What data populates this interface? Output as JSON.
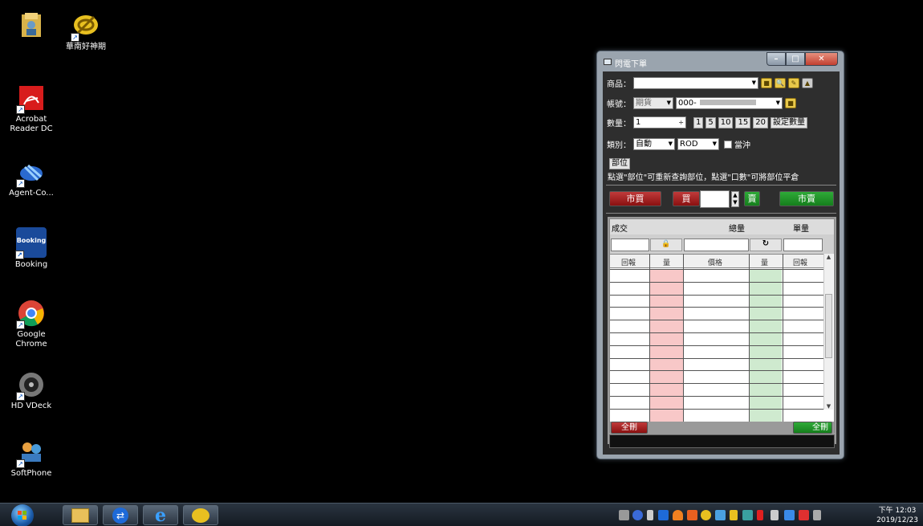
{
  "desktop": {
    "icons": [
      {
        "name": "user-folder",
        "label": ""
      },
      {
        "name": "huanan-futures",
        "label": "華南好神期"
      },
      {
        "name": "acrobat",
        "label": "Acrobat Reader DC"
      },
      {
        "name": "agent-console",
        "label": "Agent-Co..."
      },
      {
        "name": "booking",
        "label": "Booking",
        "logo": "Booking"
      },
      {
        "name": "google-chrome",
        "label": "Google Chrome"
      },
      {
        "name": "hd-vdeck",
        "label": "HD VDeck"
      },
      {
        "name": "softphone",
        "label": "SoftPhone"
      }
    ]
  },
  "window": {
    "title": "閃電下單",
    "product_label": "商品：",
    "account_label": "帳號：",
    "account_type": "期貨",
    "account_no": "000-",
    "qty_label": "數量：",
    "qty_value": "1",
    "qty_presets": [
      "1",
      "5",
      "10",
      "15",
      "20"
    ],
    "set_qty": "設定數量",
    "type_label": "類別：",
    "type_value": "自動",
    "order_type": "ROD",
    "daytrade_label": "當沖",
    "position_button": "部位",
    "hint": "點選\"部位\"可重新查詢部位，點選\"口數\"可將部位平倉",
    "market_buy": "市買",
    "buy": "買",
    "sell": "賣",
    "market_sell": "市賣",
    "grid": {
      "trade_label": "成交",
      "total_label": "總量",
      "single_label": "單量",
      "columns": [
        "回報",
        "量",
        "價格",
        "量",
        "回報"
      ],
      "clear_left": "全刪",
      "clear_right": "全刪"
    }
  },
  "taskbar": {
    "time": "下午 12:03",
    "date": "2019/12/23"
  },
  "colors": {
    "buy_col": "#f8c8c8",
    "sell_col": "#cfeacf",
    "buy_red": "#c03a3a",
    "sell_green": "#2faa38"
  }
}
